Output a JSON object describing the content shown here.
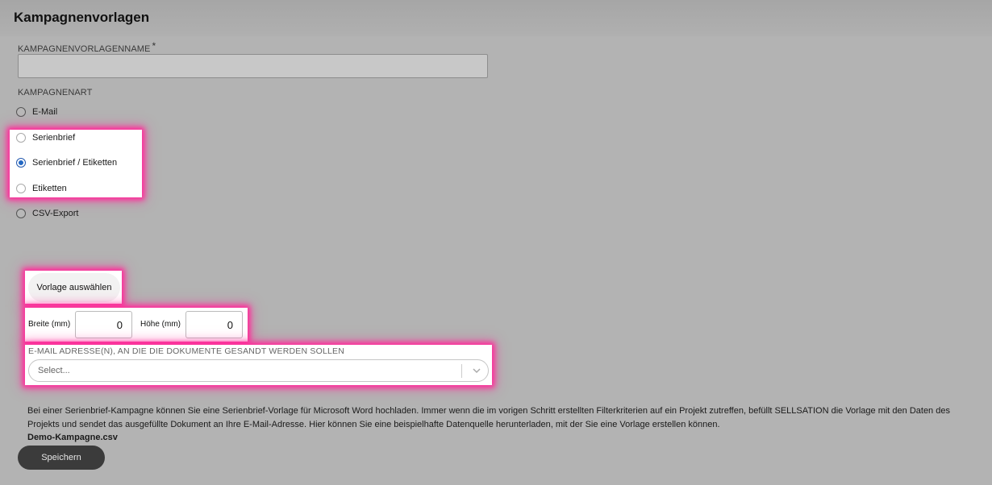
{
  "header": {
    "title": "Kampagnenvorlagen"
  },
  "form": {
    "name_label": "KAMPAGNENVORLAGENNAME",
    "required_mark": "*",
    "name_value": "",
    "type_label": "KAMPAGNENART",
    "campaign_types": [
      {
        "label": "E-Mail",
        "selected": false
      },
      {
        "label": "Serienbrief",
        "selected": false
      },
      {
        "label": "Serienbrief / Etiketten",
        "selected": true
      },
      {
        "label": "Etiketten",
        "selected": false
      },
      {
        "label": "CSV-Export",
        "selected": false
      }
    ],
    "select_template_button": "Vorlage auswählen",
    "width_label": "Breite (mm)",
    "width_value": "0",
    "height_label": "Höhe (mm)",
    "height_value": "0",
    "email_label": "E-MAIL ADRESSE(N), AN DIE DIE DOKUMENTE GESANDT WERDEN SOLLEN",
    "email_placeholder": "Select...",
    "description": "Bei einer Serienbrief-Kampagne können Sie eine Serienbrief-Vorlage für Microsoft Word hochladen. Immer wenn die im vorigen Schritt erstellten Filterkriterien auf ein Projekt zutreffen, befüllt SELLSATION die Vorlage mit den Daten des Projekts und sendet das ausgefüllte Dokument an Ihre E-Mail-Adresse. Hier können Sie eine beispielhafte Datenquelle herunterladen, mit der Sie eine Vorlage erstellen können.",
    "demo_file": "Demo-Kampagne.csv",
    "save_button": "Speichern"
  },
  "colors": {
    "overlay": "#b3b3b3",
    "highlight": "#ff2d9b",
    "radio_checked": "#2368c4",
    "save_button": "#3b3b3b"
  }
}
